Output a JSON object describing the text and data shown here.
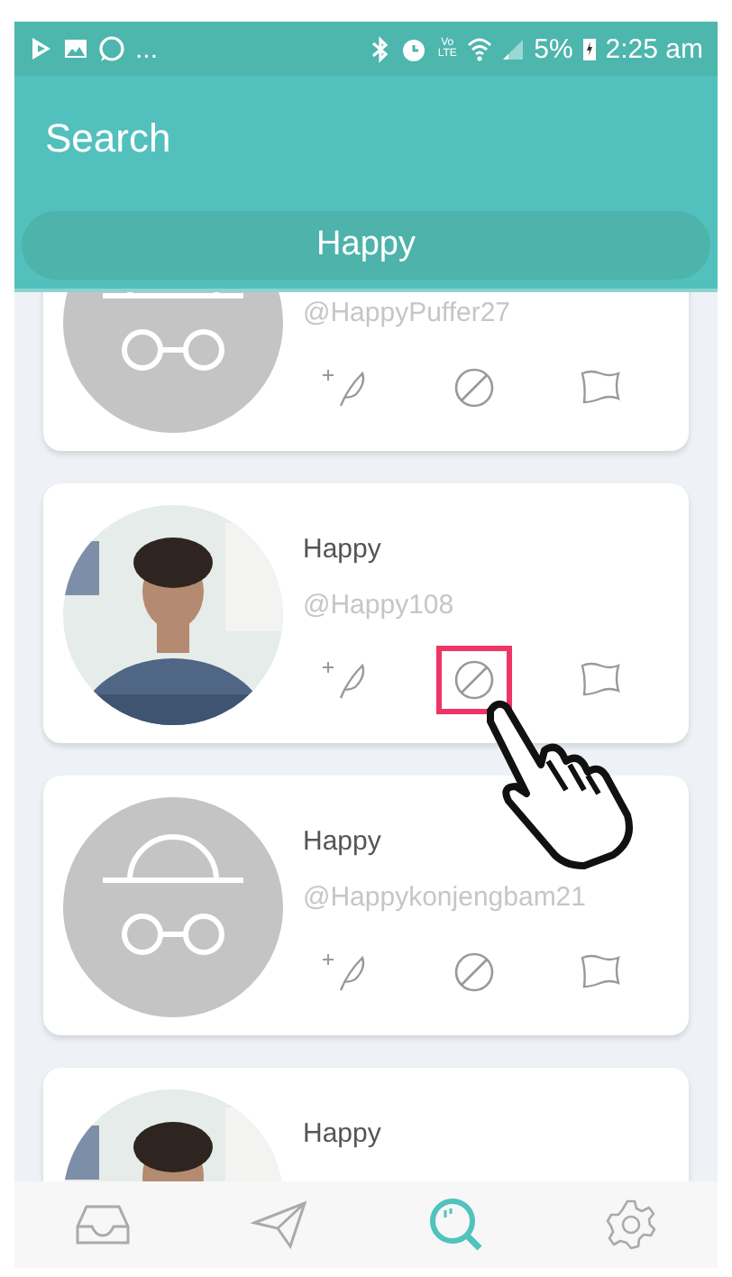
{
  "status_bar": {
    "overflow": "...",
    "network_label": "Vo LTE",
    "battery": "5%",
    "time": "2:25 am"
  },
  "header": {
    "title": "Search"
  },
  "search": {
    "value": "Happy"
  },
  "results": [
    {
      "avatar": {
        "kind": "placeholder"
      },
      "handle": "@HappyPuffer27",
      "actions": [
        {
          "kind": "follow",
          "highlighted": false
        },
        {
          "kind": "block",
          "highlighted": false
        },
        {
          "kind": "report",
          "highlighted": false
        }
      ]
    },
    {
      "avatar": {
        "kind": "picture"
      },
      "name": "Happy",
      "handle": "@Happy108",
      "actions": [
        {
          "kind": "follow",
          "highlighted": false
        },
        {
          "kind": "block",
          "highlighted": true
        },
        {
          "kind": "report",
          "highlighted": false
        }
      ]
    },
    {
      "avatar": {
        "kind": "placeholder"
      },
      "name": "Happy",
      "handle": "@Happykonjengbam21",
      "actions": [
        {
          "kind": "follow",
          "highlighted": false
        },
        {
          "kind": "block",
          "highlighted": false
        },
        {
          "kind": "report",
          "highlighted": false
        }
      ]
    },
    {
      "avatar": {
        "kind": "picture"
      },
      "name": "Happy"
    }
  ],
  "bottom_nav": [
    {
      "kind": "inbox",
      "selected": false
    },
    {
      "kind": "send",
      "selected": false
    },
    {
      "kind": "search",
      "selected": true
    },
    {
      "kind": "settings",
      "selected": false
    }
  ]
}
